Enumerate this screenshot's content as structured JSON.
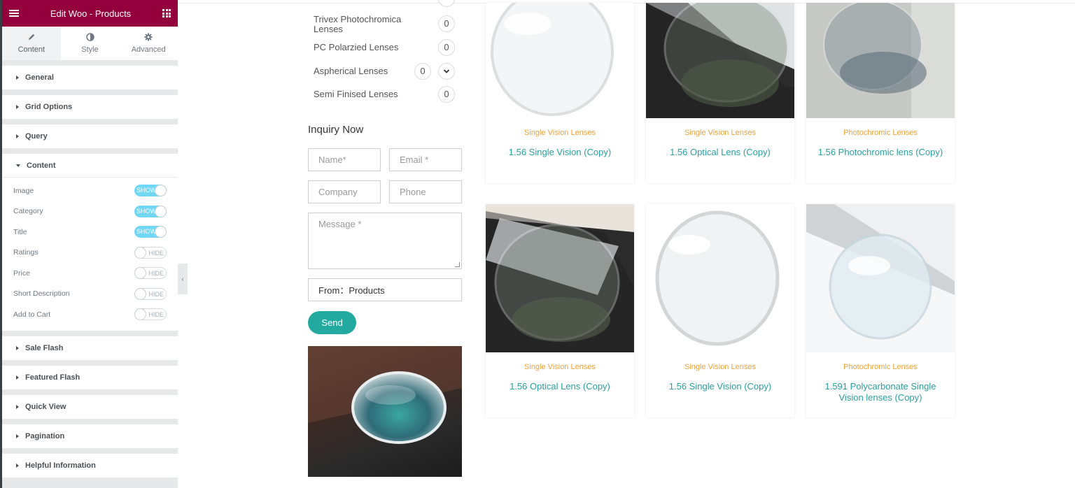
{
  "editor": {
    "header_title": "Edit Woo - Products",
    "tabs": [
      {
        "label": "Content",
        "icon": "pencil-icon"
      },
      {
        "label": "Style",
        "icon": "contrast-icon"
      },
      {
        "label": "Advanced",
        "icon": "gear-icon"
      }
    ],
    "sections": {
      "general": "General",
      "grid_options": "Grid Options",
      "query": "Query",
      "content": "Content",
      "sale_flash": "Sale Flash",
      "featured_flash": "Featured Flash",
      "quick_view": "Quick View",
      "pagination": "Pagination",
      "helpful_information": "Helpful Information"
    },
    "controls": [
      {
        "label": "Image",
        "state": "SHOW"
      },
      {
        "label": "Category",
        "state": "SHOW"
      },
      {
        "label": "Title",
        "state": "SHOW"
      },
      {
        "label": "Ratings",
        "state": "HIDE"
      },
      {
        "label": "Price",
        "state": "HIDE"
      },
      {
        "label": "Short Description",
        "state": "HIDE"
      },
      {
        "label": "Add to Cart",
        "state": "HIDE"
      }
    ],
    "accent_color": "#93003c",
    "toggle_on_color": "#71d7f7"
  },
  "categories": [
    {
      "name": "Trivex Photochromica Lenses",
      "count": "0"
    },
    {
      "name": "PC Polarzied Lenses",
      "count": "0"
    },
    {
      "name": "Aspherical Lenses",
      "count": "0"
    },
    {
      "name": "Semi Finised Lenses",
      "count": "0"
    }
  ],
  "inquiry": {
    "title": "Inquiry Now",
    "name_placeholder": "Name*",
    "email_placeholder": "Email *",
    "company_placeholder": "Company",
    "phone_placeholder": "Phone",
    "message_placeholder": "Message *",
    "from_value": "From：Products",
    "send_label": "Send",
    "button_color": "#22a9a0"
  },
  "products": [
    {
      "category": "Single Vision Lenses",
      "title": "1.56 Single Vision (Copy)"
    },
    {
      "category": "Single Vision Lenses",
      "title": "1.56 Optical Lens (Copy)"
    },
    {
      "category": "Photochromic Lenses",
      "title": "1.56 Photochromic lens (Copy)"
    },
    {
      "category": "Single Vision Lenses",
      "title": "1.56 Optical Lens (Copy)"
    },
    {
      "category": "Single Vision Lenses",
      "title": "1.56 Single Vision (Copy)"
    },
    {
      "category": "Photochromic Lenses",
      "title": "1.591 Polycarbonate Single Vision lenses (Copy)"
    }
  ],
  "colors": {
    "category_text": "#f0a23a",
    "title_text": "#2aa0a0"
  }
}
